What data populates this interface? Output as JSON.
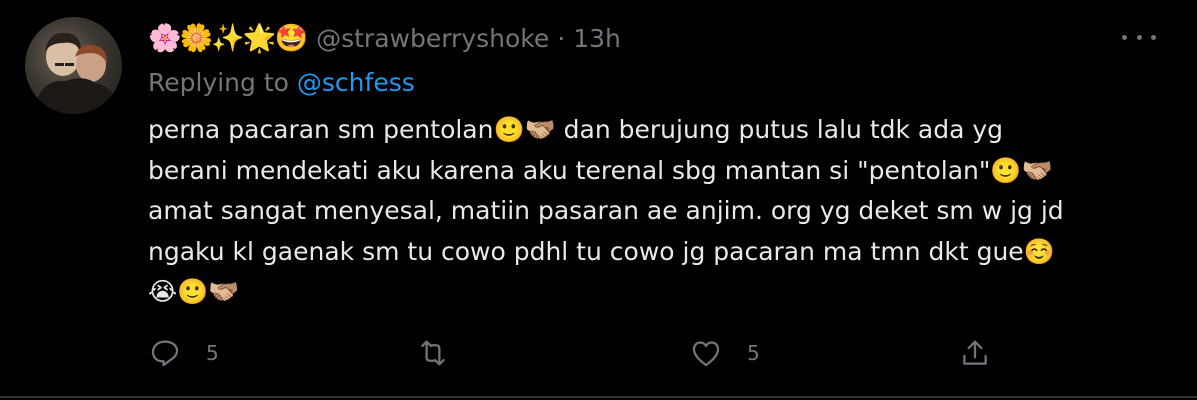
{
  "tweet": {
    "display_name": "🌸🌼✨🌟🤩",
    "handle": "@strawberryshoke",
    "separator": "·",
    "time": "13h",
    "replying_label": "Replying to",
    "replying_to": "@schfess",
    "lines": [
      "perna pacaran sm pentolan🙂🫱🏼‍🫲🏽 dan berujung putus lalu tdk ada yg",
      "berani mendekati aku karena aku terenal sbg mantan si \"pentolan\"🙂🫱🏼‍🫲🏽",
      "amat sangat menyesal, matiin pasaran ae anjim. org yg deket sm w jg jd",
      "ngaku kl gaenak sm tu cowo pdhl tu cowo jg pacaran ma tmn dkt gue☺️",
      "😭🙂🫱🏼‍🫲🏽"
    ]
  },
  "actions": {
    "reply_count": "5",
    "retweet_count": "",
    "like_count": "5"
  },
  "icons": [
    "reply-icon",
    "retweet-icon",
    "like-icon",
    "share-icon",
    "more-icon"
  ],
  "colors": {
    "background": "#000000",
    "text": "#e7e9ea",
    "muted": "#71767b",
    "link": "#1d9bf0",
    "border": "#2f3336"
  }
}
